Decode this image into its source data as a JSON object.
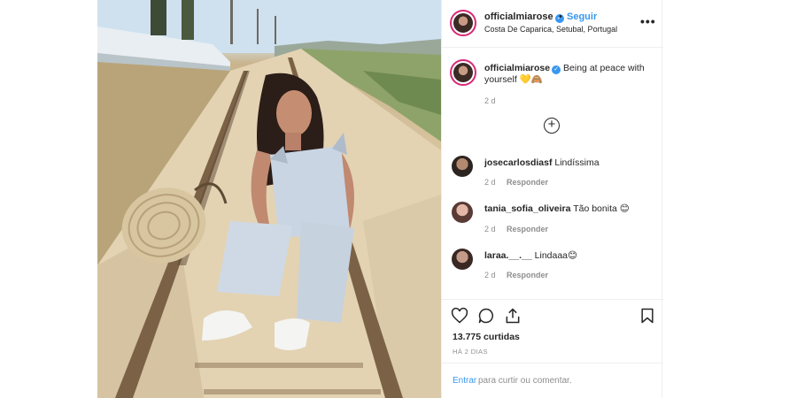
{
  "post": {
    "username": "officialmiarose",
    "follow_label": "Seguir",
    "dot": "•",
    "location": "Costa De Caparica, Setubal, Portugal",
    "more_icon": "more-horizontal-icon",
    "verified_icon": "verified-badge-icon"
  },
  "caption": {
    "username": "officialmiarose",
    "text": "Being at peace with yourself 💛🙈",
    "time": "2 d"
  },
  "load_more_icon": "plus-circle-icon",
  "comments": [
    {
      "username": "josecarlosdiasf",
      "text": "Lindíssima",
      "time": "2 d",
      "reply": "Responder"
    },
    {
      "username": "tania_sofia_oliveira",
      "text": "Tão bonita 😊",
      "time": "2 d",
      "reply": "Responder"
    },
    {
      "username": "laraa.__.__",
      "text": "Lindaaa😊",
      "time": "2 d",
      "reply": "Responder"
    }
  ],
  "actions": {
    "icons": [
      "heart-icon",
      "comment-icon",
      "share-icon",
      "bookmark-icon"
    ],
    "likes": "13.775 curtidas",
    "posted_ago": "HÁ 2 DIAS"
  },
  "login": {
    "link": "Entrar",
    "text": "para curtir ou comentar."
  },
  "colors": {
    "link_blue": "#3897f0",
    "muted": "#8e8e8e",
    "story_ring": "#d62976"
  }
}
